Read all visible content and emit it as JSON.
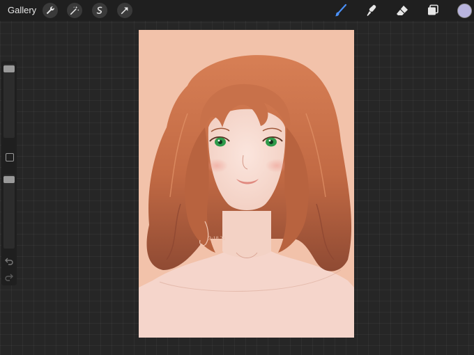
{
  "toolbar": {
    "gallery_label": "Gallery",
    "left_tools": [
      "wrench-icon",
      "magic-wand-icon",
      "selection-icon",
      "transform-arrow-icon"
    ],
    "right_tools": [
      "brush-icon",
      "smudge-icon",
      "eraser-icon",
      "layers-icon"
    ],
    "active_tool": "brush-icon",
    "current_color": "#b8b4de"
  },
  "sidebar": {
    "brush_size_level": 0.0,
    "opacity_level": 0.0
  },
  "artwork": {
    "signature_text": "J",
    "signature_subtext": "3·18.21",
    "background_color": "#f2c2aa",
    "hair_color": "#c26a44",
    "eye_color": "#2e9a4a"
  }
}
